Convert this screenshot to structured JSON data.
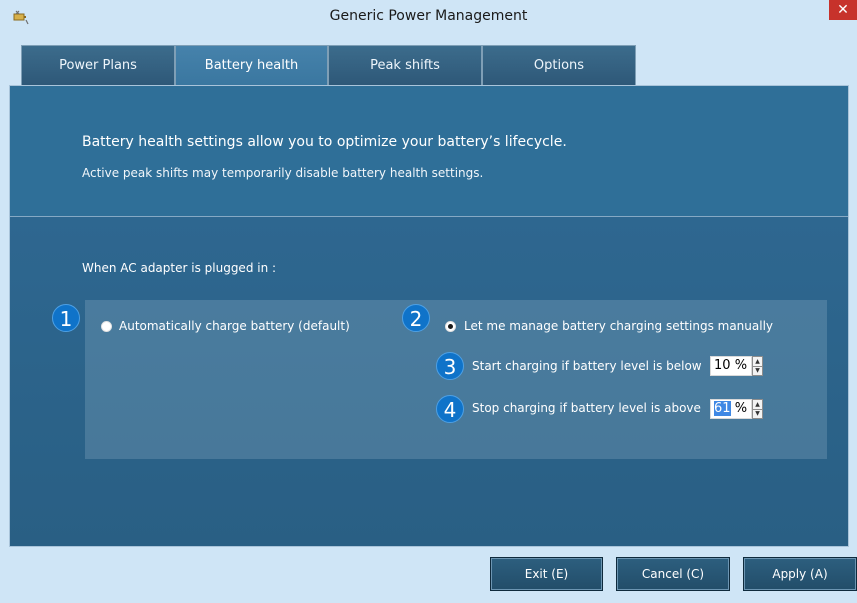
{
  "window": {
    "title": "Generic Power Management",
    "close_glyph": "✕",
    "icon": "battery-plug-icon"
  },
  "tabs": [
    {
      "label": "Power Plans"
    },
    {
      "label": "Battery health"
    },
    {
      "label": "Peak shifts"
    },
    {
      "label": "Options"
    }
  ],
  "header": {
    "description": "Battery health settings allow you to optimize your battery’s lifecycle.",
    "note": "Active peak shifts may temporarily disable battery health settings."
  },
  "section": {
    "label": "When AC adapter is plugged in :"
  },
  "options": {
    "auto": {
      "badge": "1",
      "label": "Automatically charge battery (default)",
      "selected": false
    },
    "manual": {
      "badge": "2",
      "label": "Let me manage battery charging settings manually",
      "selected": true
    },
    "start": {
      "badge": "3",
      "label": "Start charging if battery level is below",
      "value": "10",
      "unit": "%"
    },
    "stop": {
      "badge": "4",
      "label": "Stop charging if battery level is above",
      "value": "61",
      "unit": "%"
    }
  },
  "buttons": {
    "exit": "Exit (E)",
    "cancel": "Cancel (C)",
    "apply": "Apply (A)"
  },
  "colors": {
    "accent": "#0f73c9",
    "content_bg": "#2c6a92",
    "titlebar": "#cfe5f6",
    "close": "#c7322b"
  }
}
